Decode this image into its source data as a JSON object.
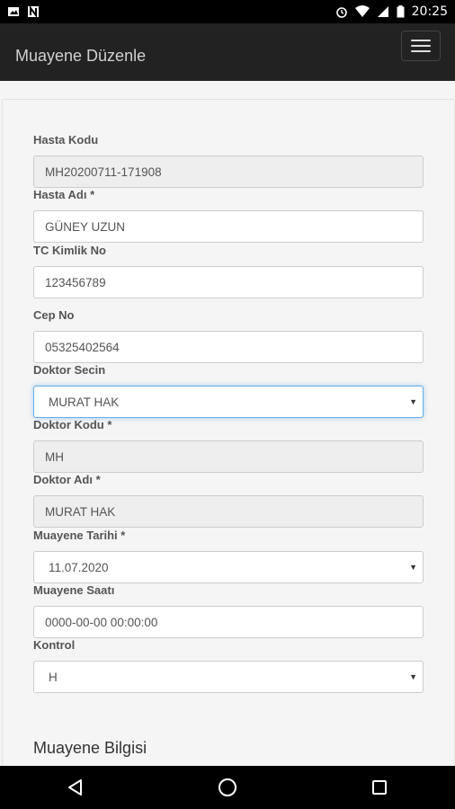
{
  "status_bar": {
    "time": "20:25"
  },
  "app_bar": {
    "title": "Muayene Düzenle"
  },
  "form": {
    "hasta_kodu": {
      "label": "Hasta Kodu",
      "value": "MH20200711-171908"
    },
    "hasta_adi": {
      "label": "Hasta Adı *",
      "value": "GÜNEY UZUN"
    },
    "tc_kimlik": {
      "label": "TC Kimlik No",
      "value": "123456789"
    },
    "cep_no": {
      "label": "Cep No",
      "value": "05325402564"
    },
    "doktor_secin": {
      "label": "Doktor Secin",
      "value": "MURAT HAK"
    },
    "doktor_kodu": {
      "label": "Doktor Kodu *",
      "value": "MH"
    },
    "doktor_adi": {
      "label": "Doktor Adı *",
      "value": "MURAT HAK"
    },
    "muayene_tarihi": {
      "label": "Muayene Tarihi *",
      "value": "11.07.2020"
    },
    "muayene_saati": {
      "label": "Muayene Saatı",
      "value": "0000-00-00 00:00:00"
    },
    "kontrol": {
      "label": "Kontrol",
      "value": "H"
    }
  },
  "section": {
    "title": "Muayene Bilgisi"
  }
}
